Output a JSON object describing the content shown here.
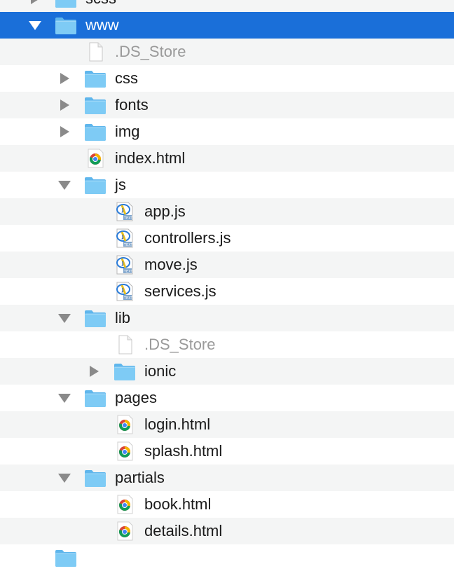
{
  "tree": {
    "rows": [
      {
        "label": "scss",
        "kind": "folder",
        "depth": 0,
        "expanded": false,
        "partial_top": true
      },
      {
        "label": "www",
        "kind": "folder",
        "depth": 0,
        "expanded": true,
        "selected": true
      },
      {
        "label": ".DS_Store",
        "kind": "blank-file",
        "depth": 1,
        "dim": true
      },
      {
        "label": "css",
        "kind": "folder",
        "depth": 1,
        "expanded": false
      },
      {
        "label": "fonts",
        "kind": "folder",
        "depth": 1,
        "expanded": false
      },
      {
        "label": "img",
        "kind": "folder",
        "depth": 1,
        "expanded": false
      },
      {
        "label": "index.html",
        "kind": "chrome-file",
        "depth": 1
      },
      {
        "label": "js",
        "kind": "folder",
        "depth": 1,
        "expanded": true
      },
      {
        "label": "app.js",
        "kind": "js-file",
        "depth": 2
      },
      {
        "label": "controllers.js",
        "kind": "js-file",
        "depth": 2
      },
      {
        "label": "move.js",
        "kind": "js-file",
        "depth": 2
      },
      {
        "label": "services.js",
        "kind": "js-file",
        "depth": 2
      },
      {
        "label": "lib",
        "kind": "folder",
        "depth": 1,
        "expanded": true
      },
      {
        "label": ".DS_Store",
        "kind": "blank-file",
        "depth": 2,
        "dim": true
      },
      {
        "label": "ionic",
        "kind": "folder",
        "depth": 2,
        "expanded": false
      },
      {
        "label": "pages",
        "kind": "folder",
        "depth": 1,
        "expanded": true
      },
      {
        "label": "login.html",
        "kind": "chrome-file",
        "depth": 2
      },
      {
        "label": "splash.html",
        "kind": "chrome-file",
        "depth": 2
      },
      {
        "label": "partials",
        "kind": "folder",
        "depth": 1,
        "expanded": true
      },
      {
        "label": "book.html",
        "kind": "chrome-file",
        "depth": 2
      },
      {
        "label": "details.html",
        "kind": "chrome-file",
        "depth": 2
      },
      {
        "label": "",
        "kind": "folder",
        "depth": 0,
        "partial_bottom": true
      }
    ]
  },
  "colors": {
    "selection": "#1a6fd9",
    "stripe": "#f4f5f5",
    "folder_blue": "#7ecbf5",
    "disclosure_gray": "#8a8a8a"
  },
  "icons": {
    "folder": "folder-icon",
    "blank-file": "document-icon",
    "chrome-file": "chrome-html-icon",
    "js-file": "javascript-file-icon"
  }
}
